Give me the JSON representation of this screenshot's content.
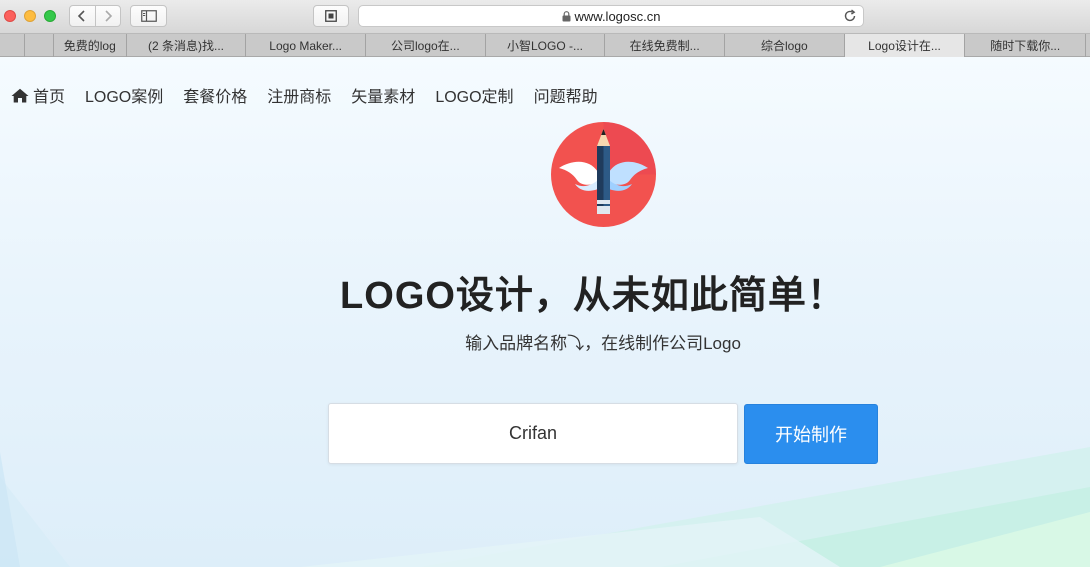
{
  "browser": {
    "url": "www.logosc.cn",
    "tabs": [
      {
        "label": ""
      },
      {
        "label": ""
      },
      {
        "label": "免费的log"
      },
      {
        "label": "(2 条消息)找..."
      },
      {
        "label": "Logo Maker..."
      },
      {
        "label": "公司logo在..."
      },
      {
        "label": "小智LOGO -..."
      },
      {
        "label": "在线免费制..."
      },
      {
        "label": "综合logo"
      },
      {
        "label": "Logo设计在..."
      },
      {
        "label": "随时下载你..."
      }
    ]
  },
  "nav": {
    "home": "首页",
    "cases": "LOGO案例",
    "pricing": "套餐价格",
    "trademark": "注册商标",
    "vector": "矢量素材",
    "custom": "LOGO定制",
    "help": "问题帮助"
  },
  "hero": {
    "headline": "LOGO设计，从未如此简单！",
    "subline": "输入品牌名称⤵，在线制作公司Logo",
    "input_value": "Crifan",
    "button_label": "开始制作"
  },
  "colors": {
    "accent": "#2b8eee",
    "badge_circle": "#f2524f"
  },
  "icons": {
    "home": "home-icon",
    "logo": "winged-pencil-icon"
  }
}
